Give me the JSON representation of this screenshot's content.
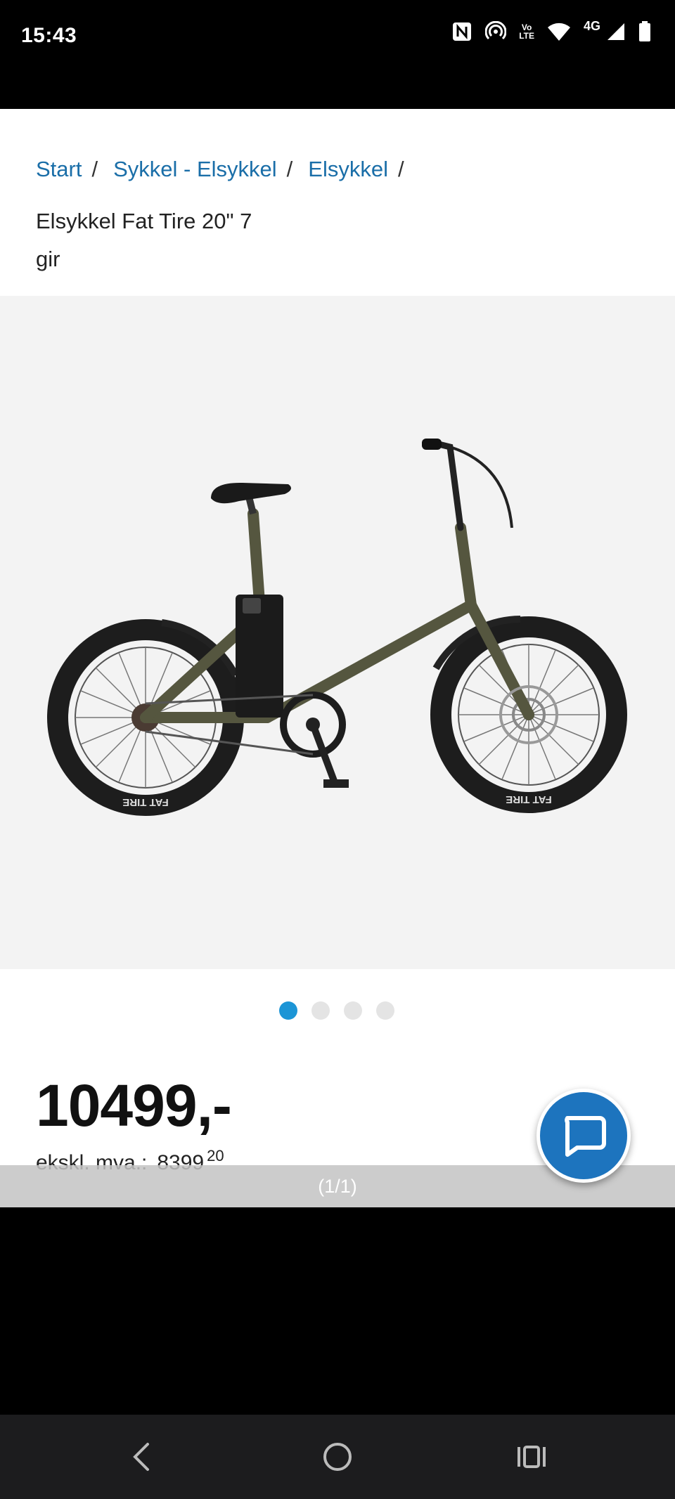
{
  "status_bar": {
    "time": "15:43",
    "network": "4G",
    "volte_top": "Vo",
    "volte_bottom": "LTE",
    "icons": [
      "nfc-icon",
      "hotspot-icon",
      "volte-icon",
      "wifi-icon",
      "signal-icon",
      "battery-icon"
    ]
  },
  "breadcrumb": {
    "items": [
      "Start",
      "Sykkel - Elsykkel",
      "Elsykkel"
    ],
    "separator": "/"
  },
  "product": {
    "title": "Elsykkel Fat Tire 20\" 7 gir",
    "image_icon": "fat-tire-ebike-image",
    "tire_text": "FAT TIRE",
    "gallery_count": 4,
    "gallery_active_index": 0,
    "price": "10499,-",
    "vat_label": "ekskl. mva.:",
    "vat_amount": "8399",
    "vat_cents": "20"
  },
  "viewer": {
    "page_indicator": "(1/1)"
  },
  "chat": {
    "icon": "chat-bubble-icon"
  },
  "nav_bar": {
    "icons": [
      "back-icon",
      "home-icon",
      "recents-icon"
    ]
  },
  "colors": {
    "link": "#1a6ea8",
    "dot_active": "#1c95d6",
    "chat_button": "#1d74be",
    "gallery_bg": "#f3f3f3"
  }
}
